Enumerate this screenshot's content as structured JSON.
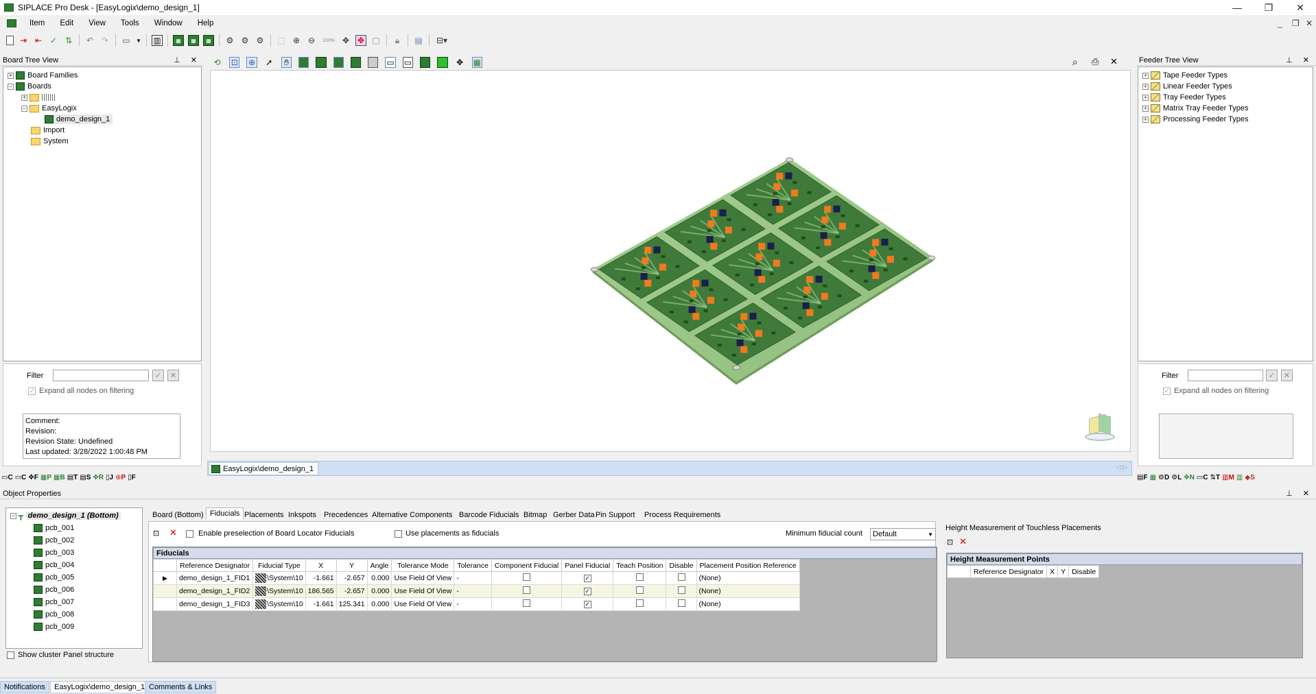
{
  "window": {
    "title": "SIPLACE Pro Desk - [EasyLogix\\demo_design_1]",
    "controls": {
      "minimize": "—",
      "restore": "❐",
      "close": "✕"
    },
    "mdi_controls": {
      "minimize": "_",
      "restore": "❐",
      "close": "✕"
    }
  },
  "menu": {
    "items": [
      "Item",
      "Edit",
      "View",
      "Tools",
      "Window",
      "Help"
    ]
  },
  "toolbar": {
    "zoom_label": "100%"
  },
  "board_tree": {
    "title": "Board Tree View",
    "nodes": [
      {
        "label": "Board Families",
        "level": 0,
        "icon": "board-icon",
        "expander": "+"
      },
      {
        "label": "Boards",
        "level": 0,
        "icon": "board-icon",
        "expander": "−"
      },
      {
        "label": "",
        "level": 1,
        "icon": "folder-icon",
        "expander": "+"
      },
      {
        "label": "EasyLogix",
        "level": 1,
        "icon": "folder-icon",
        "expander": "−"
      },
      {
        "label": "demo_design_1",
        "level": 2,
        "icon": "board-icon",
        "expander": ""
      },
      {
        "label": "Import",
        "level": 1,
        "icon": "folder-icon",
        "expander": ""
      },
      {
        "label": "System",
        "level": 1,
        "icon": "folder-icon",
        "expander": ""
      }
    ],
    "filter_label": "Filter",
    "expand_label": "Expand all nodes on filtering",
    "info": {
      "comment": "Comment:",
      "revision": "Revision:",
      "revision_state": "Revision State: Undefined",
      "last_updated": "Last updated: 3/28/2022 1:00:48 PM"
    },
    "bottom_icons": [
      "C",
      "C",
      "F",
      "P",
      "B",
      "T",
      "S",
      "R",
      "J",
      "P",
      "F"
    ]
  },
  "feeder_tree": {
    "title": "Feeder Tree View",
    "nodes": [
      "Tape Feeder Types",
      "Linear Feeder Types",
      "Tray Feeder Types",
      "Matrix Tray Feeder Types",
      "Processing Feeder Types"
    ],
    "filter_label": "Filter",
    "expand_label": "Expand all nodes on filtering",
    "bottom_icons": [
      "F",
      "",
      "D",
      "L",
      "N",
      "C",
      "T",
      "M",
      "",
      "S"
    ]
  },
  "document_tab": {
    "label": "EasyLogix\\demo_design_1"
  },
  "object_properties": {
    "title": "Object Properties",
    "root": "demo_design_1 (Bottom)",
    "pcbs": [
      "pcb_001",
      "pcb_002",
      "pcb_003",
      "pcb_004",
      "pcb_005",
      "pcb_006",
      "pcb_007",
      "pcb_008",
      "pcb_009"
    ],
    "cluster_label": "Show cluster Panel structure",
    "tabs": [
      "Board (Bottom)",
      "Fiducials",
      "Placements",
      "Inkspots",
      "Precedences",
      "Alternative Components",
      "Barcode Fiducials",
      "Bitmap",
      "Gerber Data",
      "Pin Support",
      "Process Requirements"
    ],
    "active_tab": "Fiducials",
    "enable_preselection": "Enable preselection of Board Locator Fiducials",
    "use_placements": "Use placements as fiducials",
    "min_count_label": "Minimum fiducial count",
    "min_count_value": "Default",
    "fiducials_header": "Fiducials",
    "columns": [
      "Reference Designator",
      "Fiducial Type",
      "X",
      "Y",
      "Angle",
      "Tolerance Mode",
      "Tolerance",
      "Component Fiducial",
      "Panel Fiducial",
      "Teach Position",
      "Disable",
      "Placement Position Reference"
    ],
    "rows": [
      {
        "ref": "demo_design_1_FID1",
        "type": "\\System\\10",
        "x": "-1.661",
        "y": "-2.657",
        "angle": "0.000",
        "mode": "Use Field Of View",
        "tol": "-",
        "comp": false,
        "panel": true,
        "teach": false,
        "disable": false,
        "ppr": "(None)"
      },
      {
        "ref": "demo_design_1_FID2",
        "type": "\\System\\10",
        "x": "186.565",
        "y": "-2.657",
        "angle": "0.000",
        "mode": "Use Field Of View",
        "tol": "-",
        "comp": false,
        "panel": true,
        "teach": false,
        "disable": false,
        "ppr": "(None)"
      },
      {
        "ref": "demo_design_1_FID3",
        "type": "\\System\\10",
        "x": "-1.661",
        "y": "125.341",
        "angle": "0.000",
        "mode": "Use Field Of View",
        "tol": "-",
        "comp": false,
        "panel": true,
        "teach": false,
        "disable": false,
        "ppr": "(None)"
      }
    ],
    "height_title": "Height Measurement of Touchless Placements",
    "height_points_header": "Height Measurement Points",
    "height_columns": [
      "Reference Designator",
      "X",
      "Y",
      "Disable"
    ]
  },
  "statusbar": {
    "tabs": [
      "Notifications",
      "EasyLogix\\demo_design_1",
      "Comments & Links"
    ]
  },
  "colors": {
    "board_dark": "#3f7a3a",
    "board_light": "#9fcf8c",
    "component_orange": "#f07a1e",
    "component_navy": "#1c1f4a",
    "selection_blue": "#cce0f5"
  }
}
